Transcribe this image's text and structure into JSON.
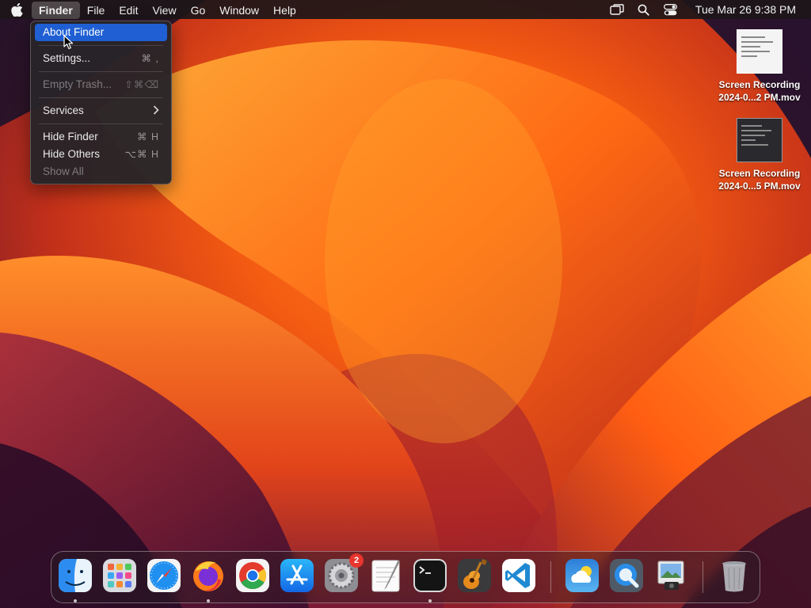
{
  "menubar": {
    "apple_icon": "apple-logo-icon",
    "app_name": "Finder",
    "items": [
      "File",
      "Edit",
      "View",
      "Go",
      "Window",
      "Help"
    ],
    "status_icons": [
      "screen-mirroring-icon",
      "search-icon",
      "control-center-icon"
    ],
    "clock": "Tue Mar 26  9:38 PM"
  },
  "finder_menu": {
    "about": "About Finder",
    "settings": "Settings...",
    "settings_shortcut": "⌘ ,",
    "empty_trash": "Empty Trash...",
    "empty_trash_shortcut": "⇧⌘⌫",
    "services": "Services",
    "hide_finder": "Hide Finder",
    "hide_finder_shortcut": "⌘ H",
    "hide_others": "Hide Others",
    "hide_others_shortcut": "⌥⌘ H",
    "show_all": "Show All"
  },
  "desktop_files": [
    {
      "name_line1": "Screen Recording",
      "name_line2": "2024-0...2 PM.mov",
      "thumbnail": "light"
    },
    {
      "name_line1": "Screen Recording",
      "name_line2": "2024-0...5 PM.mov",
      "thumbnail": "dark"
    }
  ],
  "dock": {
    "apps": [
      {
        "name": "Finder",
        "icon": "finder-icon",
        "running": true
      },
      {
        "name": "Launchpad",
        "icon": "launchpad-icon",
        "running": false
      },
      {
        "name": "Safari",
        "icon": "safari-icon",
        "running": false
      },
      {
        "name": "Firefox",
        "icon": "firefox-icon",
        "running": true
      },
      {
        "name": "Google Chrome",
        "icon": "chrome-icon",
        "running": false
      },
      {
        "name": "App Store",
        "icon": "app-store-icon",
        "running": false
      },
      {
        "name": "System Settings",
        "icon": "system-settings-icon",
        "running": false,
        "badge": "2"
      },
      {
        "name": "TextEdit",
        "icon": "textedit-icon",
        "running": false
      },
      {
        "name": "Terminal",
        "icon": "terminal-icon",
        "running": true
      },
      {
        "name": "GarageBand",
        "icon": "garageband-icon",
        "running": false
      },
      {
        "name": "Visual Studio Code",
        "icon": "vscode-icon",
        "running": false
      },
      {
        "name": "Weather",
        "icon": "weather-icon",
        "running": false
      },
      {
        "name": "QuickTime Player",
        "icon": "quicktime-icon",
        "running": false
      },
      {
        "name": "Preview",
        "icon": "preview-icon",
        "running": false
      },
      {
        "name": "Trash",
        "icon": "trash-icon",
        "running": false
      }
    ]
  },
  "colors": {
    "menu_highlight": "#1f5fd3",
    "badge": "#e8352e"
  }
}
